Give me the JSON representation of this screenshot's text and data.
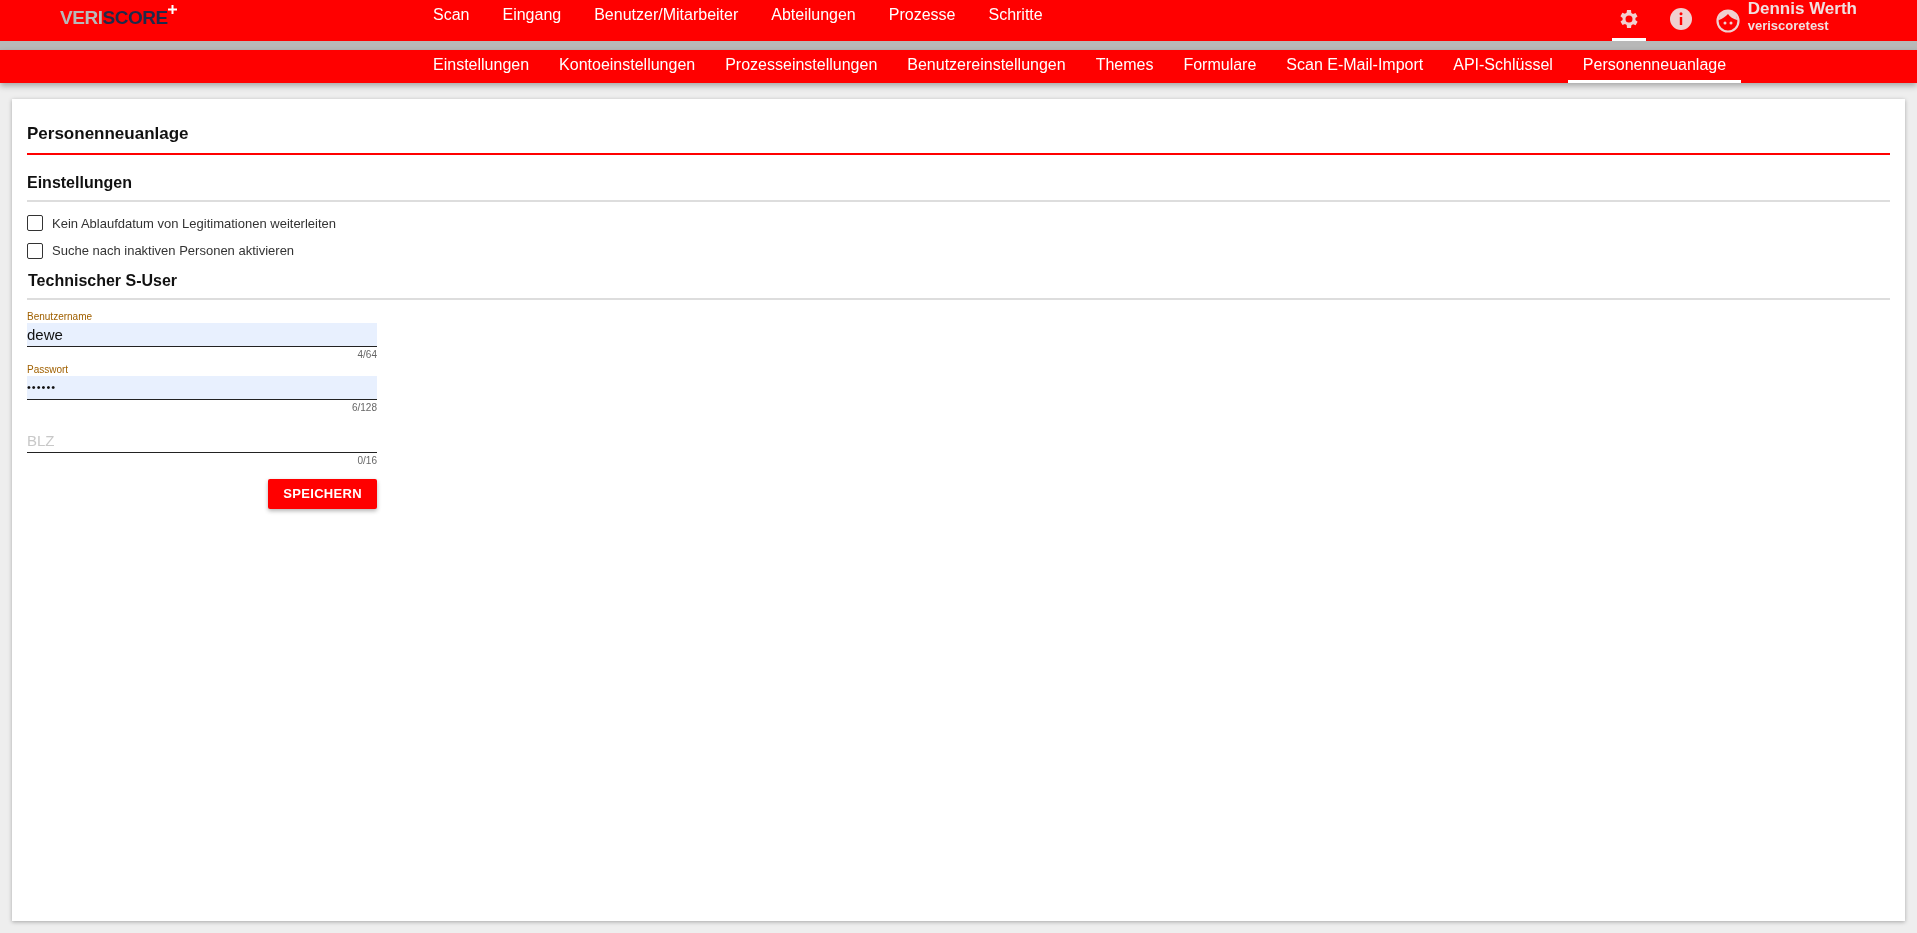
{
  "logo": {
    "first": "VERI",
    "second": "SCORE"
  },
  "main_nav": [
    {
      "label": "Scan"
    },
    {
      "label": "Eingang"
    },
    {
      "label": "Benutzer/Mitarbeiter"
    },
    {
      "label": "Abteilungen"
    },
    {
      "label": "Prozesse"
    },
    {
      "label": "Schritte"
    }
  ],
  "header_icons": [
    {
      "kind": "settings",
      "selected": true
    },
    {
      "kind": "info",
      "selected": false
    }
  ],
  "user": {
    "name": "Dennis Werth",
    "account": "veriscoretest"
  },
  "sub_nav": [
    {
      "label": "Einstellungen",
      "selected": false
    },
    {
      "label": "Kontoeinstellungen",
      "selected": false
    },
    {
      "label": "Prozesseinstellungen",
      "selected": false
    },
    {
      "label": "Benutzereinstellungen",
      "selected": false
    },
    {
      "label": "Themes",
      "selected": false
    },
    {
      "label": "Formulare",
      "selected": false
    },
    {
      "label": "Scan E-Mail-Import",
      "selected": false
    },
    {
      "label": "API-Schlüssel",
      "selected": false
    },
    {
      "label": "Personenneuanlage",
      "selected": true
    }
  ],
  "page_title": "Personenneuanlage",
  "settings_section": {
    "title": "Einstellungen",
    "checkboxes": [
      {
        "label": "Kein Ablaufdatum von Legitimationen weiterleiten",
        "checked": false
      },
      {
        "label": "Suche nach inaktiven Personen aktivieren",
        "checked": false
      }
    ]
  },
  "user_section": {
    "title": "Technischer S-User",
    "fields": [
      {
        "kind": "text",
        "label": "Benutzername",
        "value": "dewe",
        "counter": "4/64"
      },
      {
        "kind": "password",
        "label": "Passwort",
        "value": "••••••",
        "counter": "6/128"
      },
      {
        "kind": "text",
        "placeholder": "BLZ",
        "counter": "0/16"
      }
    ],
    "save_button": "SPEICHERN"
  }
}
